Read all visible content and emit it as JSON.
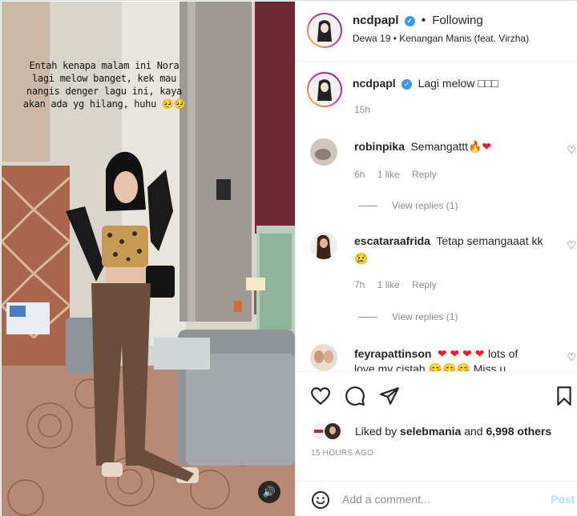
{
  "header": {
    "username": "ncdpapl",
    "separator": "•",
    "follow_state": "Following",
    "song": "Dewa 19 • Kenangan Manis (feat. Virzha)"
  },
  "media": {
    "overlay_text": "Entah kenapa malam ini Nora lagi melow banget, kek mau nangis denger lagu ini, kaya akan ada yg hilang, huhu 🥺🥺"
  },
  "caption": {
    "username": "ncdpapl",
    "text": "Lagi melow □□□",
    "time": "15h"
  },
  "comments": [
    {
      "username": "robinpika",
      "text": "Semangattt🔥",
      "heart": "❤",
      "time": "6h",
      "likes": "1 like",
      "reply": "Reply",
      "view_replies": "View replies (1)"
    },
    {
      "username": "escataraafrida",
      "text": "Tetap semangaaat kk",
      "emoji": "😢",
      "time": "7h",
      "likes": "1 like",
      "reply": "Reply",
      "view_replies": "View replies (1)"
    },
    {
      "username": "feyrapattinson",
      "hearts": "❤ ❤ ❤ ❤",
      "text": "lots of",
      "text2": "love my cistah 😊😊😊 Miss u"
    }
  ],
  "likes": {
    "prefix": "Liked by",
    "user": "selebmania",
    "and": "and",
    "count": "6,998 others"
  },
  "timestamp": "15 HOURS AGO",
  "add_comment": {
    "placeholder": "Add a comment...",
    "post_label": "Post"
  },
  "colors": {
    "verified": "#3897f0",
    "post_disabled": "#b2dffc",
    "heart": "#ed1c24"
  }
}
